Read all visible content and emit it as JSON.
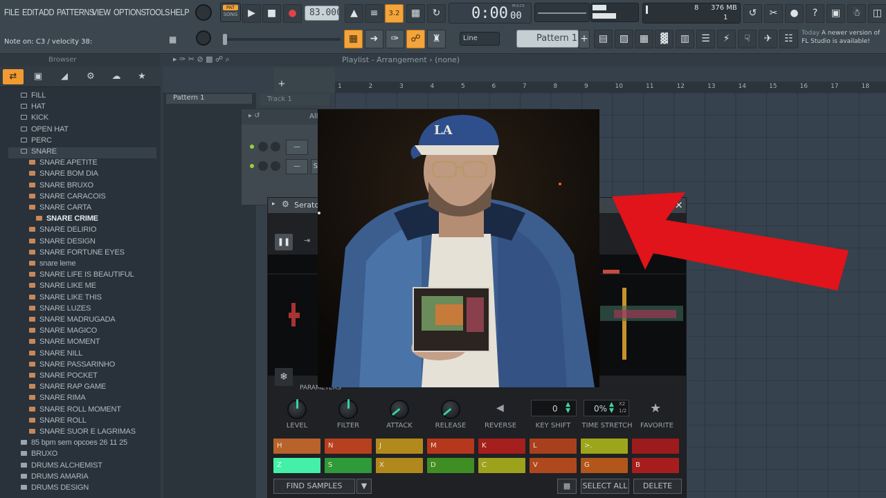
{
  "menu": [
    "FILE",
    "EDIT",
    "ADD",
    "PATTERNS",
    "VIEW",
    "OPTIONS",
    "TOOLS",
    "HELP"
  ],
  "transport": {
    "pat_label": "PAT",
    "song_label": "SONG",
    "tempo": "83.000",
    "time": "0:00",
    "time_sub": "00",
    "time_unit": "M:S:CS"
  },
  "monitor": {
    "cpu_num": "8",
    "ram": "376 MB",
    "poly": "1"
  },
  "hint": "Note on: C3 / velocity 38:",
  "snap": "Line",
  "pattern_selector": "Pattern 1",
  "news": {
    "date": "Today",
    "text": "A newer version of FL Studio is available!"
  },
  "browser": {
    "title": "Browser",
    "items": [
      {
        "label": "FILL",
        "type": "folder",
        "indent": 1
      },
      {
        "label": "HAT",
        "type": "folder",
        "indent": 1
      },
      {
        "label": "KICK",
        "type": "folder",
        "indent": 1
      },
      {
        "label": "OPEN HAT",
        "type": "folder",
        "indent": 1
      },
      {
        "label": "PERC",
        "type": "folder",
        "indent": 1
      },
      {
        "label": "SNARE",
        "type": "folder",
        "indent": 1
      },
      {
        "label": "SNARE APETITE",
        "type": "file",
        "indent": 2
      },
      {
        "label": "SNARE BOM DIA",
        "type": "file",
        "indent": 2
      },
      {
        "label": "SNARE BRUXO",
        "type": "file",
        "indent": 2
      },
      {
        "label": "SNARE CARACOIS",
        "type": "file",
        "indent": 2
      },
      {
        "label": "SNARE CARTA",
        "type": "file",
        "indent": 2
      },
      {
        "label": "SNARE CRIME",
        "type": "file",
        "indent": 3
      },
      {
        "label": "SNARE DELIRIO",
        "type": "file",
        "indent": 2
      },
      {
        "label": "SNARE DESIGN",
        "type": "file",
        "indent": 2
      },
      {
        "label": "SNARE FORTUNE EYES",
        "type": "file",
        "indent": 2
      },
      {
        "label": "snare leme",
        "type": "file",
        "indent": 2
      },
      {
        "label": "SNARE LIFE IS BEAUTIFUL",
        "type": "file",
        "indent": 2
      },
      {
        "label": "SNARE LIKE ME",
        "type": "file",
        "indent": 2
      },
      {
        "label": "SNARE LIKE THIS",
        "type": "file",
        "indent": 2
      },
      {
        "label": "SNARE LUZES",
        "type": "file",
        "indent": 2
      },
      {
        "label": "SNARE MADRUGADA",
        "type": "file",
        "indent": 2
      },
      {
        "label": "SNARE MAGICO",
        "type": "file",
        "indent": 2
      },
      {
        "label": "SNARE MOMENT",
        "type": "file",
        "indent": 2
      },
      {
        "label": "SNARE NILL",
        "type": "file",
        "indent": 2
      },
      {
        "label": "SNARE PASSARINHO",
        "type": "file",
        "indent": 2
      },
      {
        "label": "SNARE POCKET",
        "type": "file",
        "indent": 2
      },
      {
        "label": "SNARE RAP GAME",
        "type": "file",
        "indent": 2
      },
      {
        "label": "SNARE RIMA",
        "type": "file",
        "indent": 2
      },
      {
        "label": "SNARE ROLL MOMENT",
        "type": "file",
        "indent": 2
      },
      {
        "label": "SNARE ROLL",
        "type": "file",
        "indent": 2
      },
      {
        "label": "SNARE SUOR E LAGRIMAS",
        "type": "file",
        "indent": 2
      },
      {
        "label": "85 bpm sem opcoes 26 11 25",
        "type": "doc",
        "indent": 1
      },
      {
        "label": "BRUXO",
        "type": "doc",
        "indent": 1
      },
      {
        "label": "DRUMS ALCHEMIST",
        "type": "doc",
        "indent": 1
      },
      {
        "label": "DRUMS AMARIA",
        "type": "doc",
        "indent": 1
      },
      {
        "label": "DRUMS DESIGN",
        "type": "doc",
        "indent": 1
      }
    ]
  },
  "playlist": {
    "title": "Playlist - Arrangement",
    "subtitle": "(none)",
    "pattern": "Pattern 1",
    "track": "Track 1",
    "ruler": [
      "1",
      "2",
      "3",
      "4",
      "5",
      "6",
      "7",
      "8",
      "9",
      "10",
      "11",
      "12",
      "13",
      "14",
      "15",
      "16",
      "17",
      "18"
    ]
  },
  "rack": {
    "filter": "All",
    "row_labels": [
      "—",
      "Se"
    ]
  },
  "serato": {
    "title": "Serato",
    "tab_label": "PARAMETERS",
    "knobs": [
      "LEVEL",
      "FILTER",
      "ATTACK",
      "RELEASE"
    ],
    "reverse": "REVERSE",
    "key_shift_label": "KEY SHIFT",
    "key_shift_value": "0",
    "time_stretch_label": "TIME STRETCH",
    "time_stretch_value": "0%",
    "stretch_x2": "X2",
    "stretch_half": "1/2",
    "favorite": "FAVORITE",
    "pads_row1": [
      {
        "key": "H",
        "color": "#b8622c"
      },
      {
        "key": "N",
        "color": "#b7401f"
      },
      {
        "key": "J",
        "color": "#b28a1c"
      },
      {
        "key": "M",
        "color": "#b5371c"
      },
      {
        "key": "K",
        "color": "#a51f1d"
      },
      {
        "key": "L",
        "color": "#a8401d"
      },
      {
        "key": ">.",
        "color": "#9da51c"
      },
      {
        "key": "",
        "color": "#9c1b1c"
      }
    ],
    "pads_row2": [
      {
        "key": "Z",
        "color": "#44f0a8"
      },
      {
        "key": "S",
        "color": "#2f9a3a"
      },
      {
        "key": "X",
        "color": "#b0881c"
      },
      {
        "key": "D",
        "color": "#3f8e24"
      },
      {
        "key": "C",
        "color": "#9ca21c"
      },
      {
        "key": "V",
        "color": "#b0481d"
      },
      {
        "key": "G",
        "color": "#b2561c"
      },
      {
        "key": "B",
        "color": "#a51e1d"
      }
    ],
    "find_samples": "FIND SAMPLES",
    "select_all": "SELECT ALL",
    "delete": "DELETE",
    "close": "×"
  },
  "colors": {
    "accent": "#f4a43a",
    "arrow": "#e0141a",
    "teal": "#2fd6a0"
  }
}
